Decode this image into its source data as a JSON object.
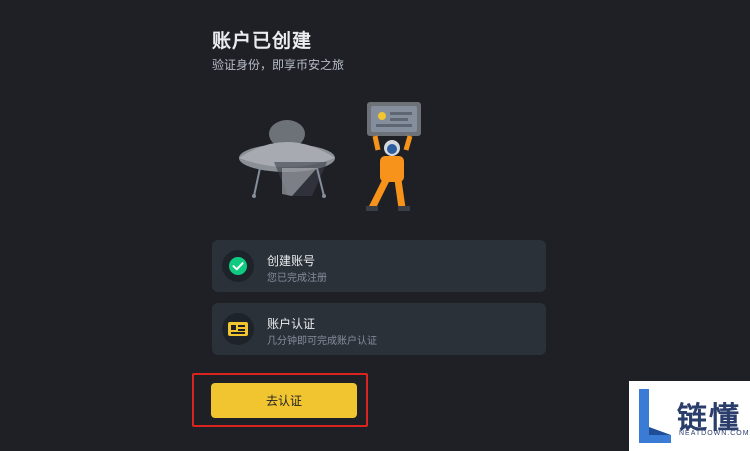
{
  "page": {
    "title": "账户已创建",
    "subtitle": "验证身份，即享币安之旅"
  },
  "illustration": {
    "name": "astronaut-with-id-card-and-ufo"
  },
  "steps": [
    {
      "title": "创建账号",
      "description": "您已完成注册",
      "status": "completed",
      "icon": "check-circle-icon"
    },
    {
      "title": "账户认证",
      "description": "几分钟即可完成账户认证",
      "status": "pending",
      "icon": "id-card-icon"
    }
  ],
  "cta": {
    "label": "去认证"
  },
  "watermark": {
    "text": "链懂",
    "subtext": "NEATDOWN.COM"
  },
  "colors": {
    "background": "#1e2026",
    "card": "#2b3139",
    "accent_yellow": "#f0c52f",
    "success_green": "#0ecb81",
    "highlight_red": "#d8251f"
  }
}
